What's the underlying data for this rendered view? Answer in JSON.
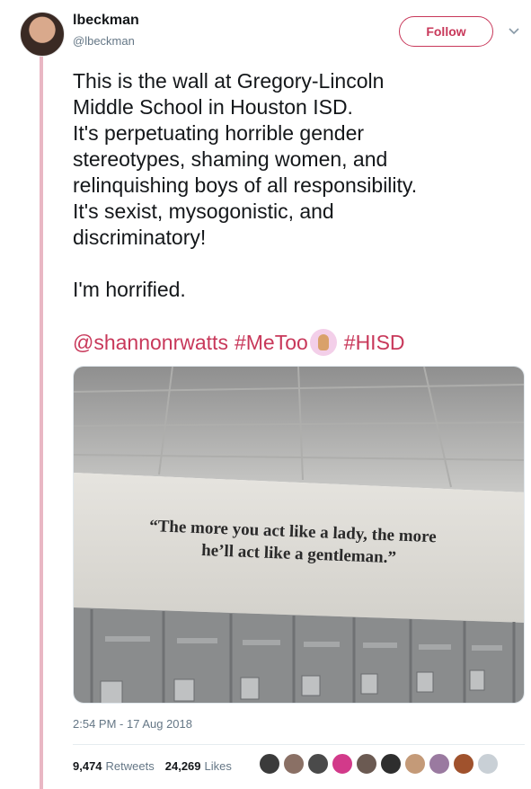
{
  "author": {
    "display_name": "lbeckman",
    "handle": "@lbeckman"
  },
  "follow_label": "Follow",
  "tweet": {
    "text": "This is the wall at Gregory-Lincoln\nMiddle School in Houston ISD.\nIt's perpetuating horrible gender\nstereotypes, shaming women, and\nrelinquishing boys of all responsibility.\nIt's sexist, mysogonistic, and\ndiscriminatory!\n\nI'm horrified.",
    "mention": "@shannonrwatts",
    "hashtag_metoo": "#MeToo",
    "hashtag_hisd": "#HISD"
  },
  "photo": {
    "quote_line1": "“The more you act like a lady, the more",
    "quote_line2": "he’ll act like a gentleman.”"
  },
  "timestamp": "2:54 PM - 17 Aug 2018",
  "stats": {
    "retweets_count": "9,474",
    "retweets_label": "Retweets",
    "likes_count": "24,269",
    "likes_label": "Likes"
  },
  "colors": {
    "accent": "#c8385a",
    "thread_line": "#e9b7c4",
    "text_secondary": "#657786"
  },
  "liker_colors": [
    "#3b3b3b",
    "#8a7065",
    "#4a4a4a",
    "#d23a8a",
    "#6b5a52",
    "#2e2e2e",
    "#c49a78",
    "#9a7aa0",
    "#a0522d",
    "#c9d0d6"
  ]
}
